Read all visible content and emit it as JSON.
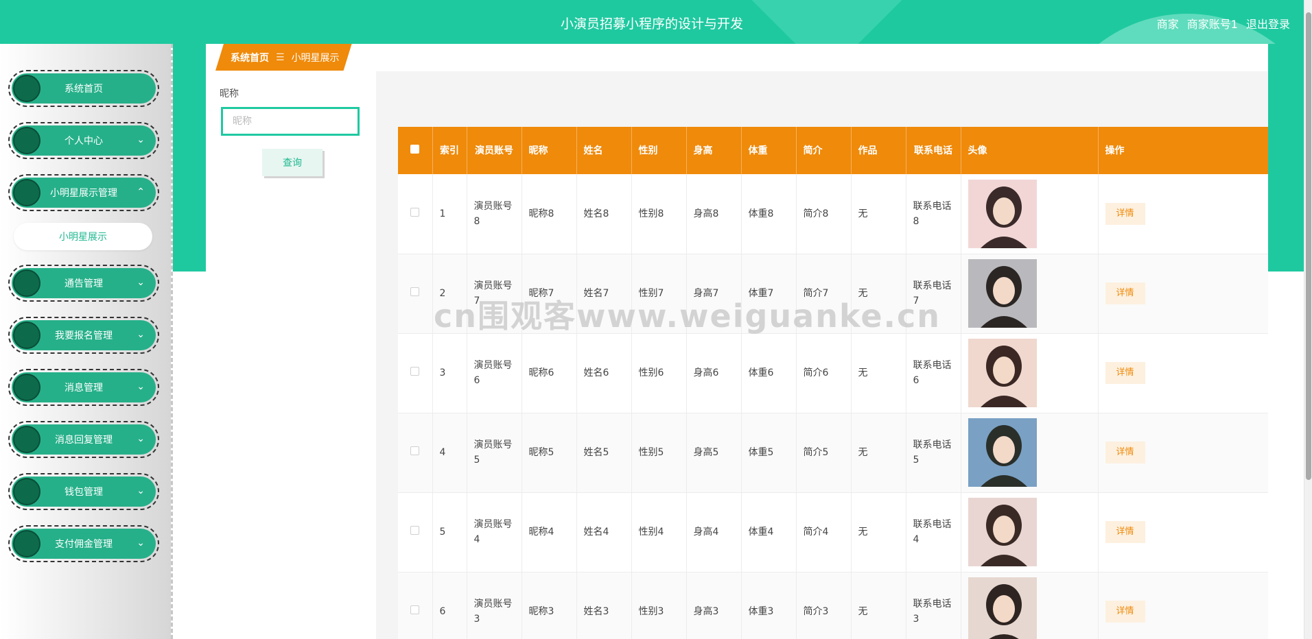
{
  "header": {
    "title": "小演员招募小程序的设计与开发",
    "role": "商家",
    "account": "商家账号1",
    "logout": "退出登录"
  },
  "sidebar": {
    "items": [
      {
        "label": "系统首页",
        "chevron": ""
      },
      {
        "label": "个人中心",
        "chevron": "⌄"
      },
      {
        "label": "小明星展示管理",
        "chevron": "⌃"
      },
      {
        "label": "通告管理",
        "chevron": "⌄"
      },
      {
        "label": "我要报名管理",
        "chevron": "⌄"
      },
      {
        "label": "消息管理",
        "chevron": "⌄"
      },
      {
        "label": "消息回复管理",
        "chevron": "⌄"
      },
      {
        "label": "钱包管理",
        "chevron": "⌄"
      },
      {
        "label": "支付佣金管理",
        "chevron": "⌄"
      }
    ],
    "submenu": "小明星展示"
  },
  "breadcrumb": {
    "home": "系统首页",
    "sep": "☰",
    "current": "小明星展示"
  },
  "filter": {
    "label": "昵称",
    "placeholder": "昵称",
    "value": "",
    "query_button": "查询"
  },
  "table": {
    "headers": [
      "索引",
      "演员账号",
      "昵称",
      "姓名",
      "性别",
      "身高",
      "体重",
      "简介",
      "作品",
      "联系电话",
      "头像",
      "操作"
    ],
    "rows": [
      {
        "index": "1",
        "account": "演员账号8",
        "nickname": "昵称8",
        "name": "姓名8",
        "gender": "性别8",
        "height": "身高8",
        "weight": "体重8",
        "intro": "简介8",
        "works": "无",
        "phone": "联系电话8",
        "action": "详情"
      },
      {
        "index": "2",
        "account": "演员账号7",
        "nickname": "昵称7",
        "name": "姓名7",
        "gender": "性别7",
        "height": "身高7",
        "weight": "体重7",
        "intro": "简介7",
        "works": "无",
        "phone": "联系电话7",
        "action": "详情"
      },
      {
        "index": "3",
        "account": "演员账号6",
        "nickname": "昵称6",
        "name": "姓名6",
        "gender": "性别6",
        "height": "身高6",
        "weight": "体重6",
        "intro": "简介6",
        "works": "无",
        "phone": "联系电话6",
        "action": "详情"
      },
      {
        "index": "4",
        "account": "演员账号5",
        "nickname": "昵称5",
        "name": "姓名5",
        "gender": "性别5",
        "height": "身高5",
        "weight": "体重5",
        "intro": "简介5",
        "works": "无",
        "phone": "联系电话5",
        "action": "详情"
      },
      {
        "index": "5",
        "account": "演员账号4",
        "nickname": "昵称4",
        "name": "姓名4",
        "gender": "性别4",
        "height": "身高4",
        "weight": "体重4",
        "intro": "简介4",
        "works": "无",
        "phone": "联系电话4",
        "action": "详情"
      },
      {
        "index": "6",
        "account": "演员账号3",
        "nickname": "昵称3",
        "name": "姓名3",
        "gender": "性别3",
        "height": "身高3",
        "weight": "体重3",
        "intro": "简介3",
        "works": "无",
        "phone": "联系电话3",
        "action": "详情"
      }
    ]
  },
  "watermark": "cn围观客www.weiguanke.cn",
  "colors": {
    "primary": "#1fc9a0",
    "menu_green": "#26b08a",
    "menu_dot": "#0d6b4b",
    "header_orange": "#ef8a0a",
    "detail_bg": "#fdf0df"
  }
}
